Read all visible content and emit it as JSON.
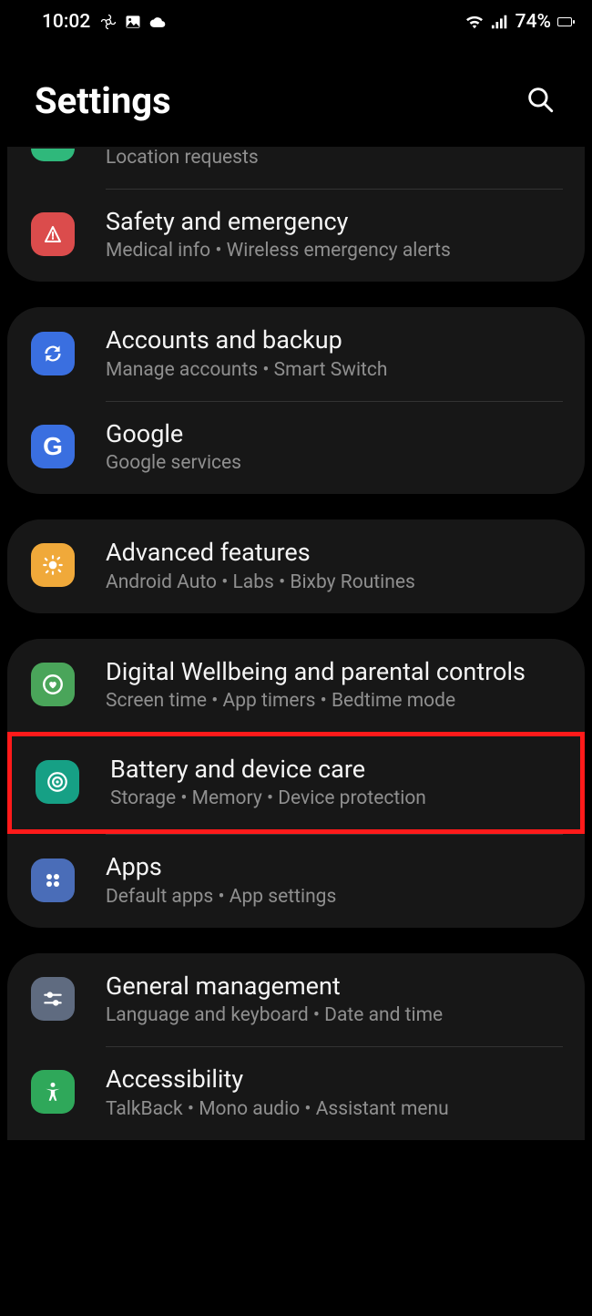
{
  "status": {
    "time": "10:02",
    "battery_pct": "74%"
  },
  "header": {
    "title": "Settings"
  },
  "groups": [
    {
      "items": [
        {
          "key": "location",
          "title": "",
          "sub": "Location requests",
          "icon_bg": "#2fb87b",
          "cut": true
        },
        {
          "key": "safety",
          "title": "Safety and emergency",
          "sub": "Medical info  •  Wireless emergency alerts",
          "icon_bg": "#db4c4c"
        }
      ]
    },
    {
      "items": [
        {
          "key": "accounts",
          "title": "Accounts and backup",
          "sub": "Manage accounts  •  Smart Switch",
          "icon_bg": "#3a6fe0"
        },
        {
          "key": "google",
          "title": "Google",
          "sub": "Google services",
          "icon_bg": "#3a6fe0"
        }
      ]
    },
    {
      "items": [
        {
          "key": "advanced",
          "title": "Advanced features",
          "sub": "Android Auto  •  Labs  •  Bixby Routines",
          "icon_bg": "#f0a93a"
        }
      ]
    },
    {
      "items": [
        {
          "key": "wellbeing",
          "title": "Digital Wellbeing and parental controls",
          "sub": "Screen time  •  App timers  •  Bedtime mode",
          "icon_bg": "#4aa55a"
        },
        {
          "key": "battery",
          "title": "Battery and device care",
          "sub": "Storage  •  Memory  •  Device protection",
          "icon_bg": "#16a085",
          "highlight": true
        },
        {
          "key": "apps",
          "title": "Apps",
          "sub": "Default apps  •  App settings",
          "icon_bg": "#4a6db8"
        }
      ]
    },
    {
      "items": [
        {
          "key": "general",
          "title": "General management",
          "sub": "Language and keyboard  •  Date and time",
          "icon_bg": "#5f6b80"
        },
        {
          "key": "accessibility",
          "title": "Accessibility",
          "sub": "TalkBack  •  Mono audio  •  Assistant menu",
          "icon_bg": "#2fa85a"
        }
      ]
    }
  ]
}
